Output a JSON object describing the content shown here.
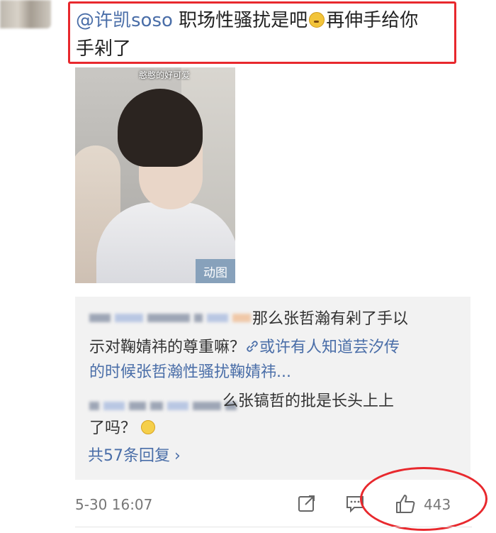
{
  "comment": {
    "user": "@许凯soso",
    "text_part1": " 职场性骚扰是吧",
    "text_part2": "再伸手给你",
    "text_line2": "手剁了",
    "emoji": "thinking-face-emoji"
  },
  "media": {
    "caption": "憨憨的好可爱",
    "badge": "动图"
  },
  "replies": {
    "reply1_line1": "那么张哲瀚有剁了手以",
    "reply1_line2_prefix": "示对鞠婧祎的尊重嘛？",
    "reply1_link_line2": "或许有人知道芸汐传",
    "reply1_link_line3": "的时候张哲瀚性骚扰鞠婧祎...",
    "reply2_line1": "么张镐哲的批是长头上上",
    "reply2_line2": "了吗？",
    "more": "共57条回复",
    "more_chevron": "›"
  },
  "footer": {
    "timestamp": "5-30 16:07",
    "like_count": "443"
  },
  "colors": {
    "accent_link": "#4a6ea8",
    "highlight_red": "#e8282d"
  }
}
